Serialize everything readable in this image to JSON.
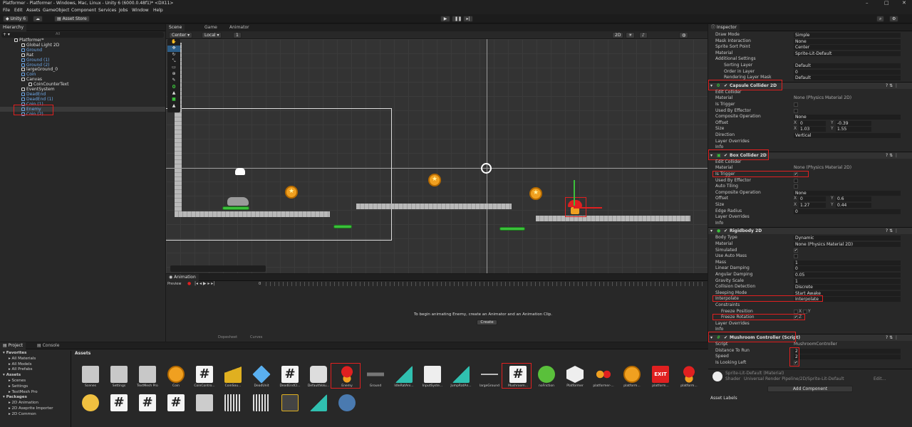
{
  "window": {
    "title": "Platformer - Platformer - Windows, Mac, Linux - Unity 6 (6000.0.48f1)* <DX11>"
  },
  "menu": [
    "File",
    "Edit",
    "Assets",
    "GameObject",
    "Component",
    "Services",
    "Jobs",
    "Window",
    "Help"
  ],
  "toolbar": {
    "account": "Unity 6",
    "asset_store": "Asset Store"
  },
  "hierarchy": {
    "tab": "Hierarchy",
    "search_placeholder": "All",
    "items": [
      {
        "label": "Platformer*",
        "indent": 0,
        "color": "#dddddd"
      },
      {
        "label": "Global Light 2D",
        "indent": 1,
        "color": "#dddddd"
      },
      {
        "label": "Ground",
        "indent": 1,
        "color": "#6fa8e8"
      },
      {
        "label": "Rat",
        "indent": 1,
        "color": "#dddddd"
      },
      {
        "label": "Ground (1)",
        "indent": 1,
        "color": "#6fa8e8"
      },
      {
        "label": "Ground (2)",
        "indent": 1,
        "color": "#6fa8e8"
      },
      {
        "label": "largeGround_0",
        "indent": 1,
        "color": "#dddddd"
      },
      {
        "label": "Coin",
        "indent": 1,
        "color": "#6fa8e8"
      },
      {
        "label": "Canvas",
        "indent": 1,
        "color": "#dddddd"
      },
      {
        "label": "CoinCounterText",
        "indent": 2,
        "color": "#dddddd"
      },
      {
        "label": "EventSystem",
        "indent": 1,
        "color": "#dddddd"
      },
      {
        "label": "DeadEnd",
        "indent": 1,
        "color": "#6fa8e8"
      },
      {
        "label": "DeadEnd (1)",
        "indent": 1,
        "color": "#6fa8e8"
      },
      {
        "label": "Coin (1)",
        "indent": 1,
        "color": "#6fa8e8"
      },
      {
        "label": "Enemy",
        "indent": 1,
        "color": "#6fa8e8"
      },
      {
        "label": "Coin (2)",
        "indent": 1,
        "color": "#6fa8e8"
      }
    ]
  },
  "scene": {
    "tabs": [
      "Scene",
      "Game",
      "Animator"
    ],
    "pivot": "Center",
    "space": "Local",
    "grid_size": "1",
    "mode_2d": "2D"
  },
  "animation": {
    "tab": "Animation",
    "preview": "Preview",
    "frame": "0",
    "message": "To begin animating Enemy, create an Animator and an Animation Clip.",
    "create_button": "Create",
    "dopesheet": "Dopesheet",
    "curves": "Curves"
  },
  "inspector": {
    "tab": "Inspector",
    "sprite_rows": [
      {
        "label": "Draw Mode",
        "value": "Simple"
      },
      {
        "label": "Mask Interaction",
        "value": "None"
      },
      {
        "label": "Sprite Sort Point",
        "value": "Center"
      },
      {
        "label": "Material",
        "value": "Sprite-Lit-Default"
      }
    ],
    "additional_settings": "Additional Settings",
    "additional_rows": [
      {
        "label": "Sorting Layer",
        "value": "Default"
      },
      {
        "label": "Order in Layer",
        "value": "0"
      },
      {
        "label": "Rendering Layer Mask",
        "value": "Default"
      }
    ],
    "capsule": {
      "title": "Capsule Collider 2D",
      "edit_collider": "Edit Collider",
      "material_label": "Material",
      "material": "None (Physics Material 2D)",
      "is_trigger": "Is Trigger",
      "used_by_effector": "Used By Effector",
      "composite_label": "Composite Operation",
      "composite": "None",
      "offset_label": "Offset",
      "offset_x": "0",
      "offset_y": "-0.39",
      "size_label": "Size",
      "size_x": "1.03",
      "size_y": "1.55",
      "direction_label": "Direction",
      "direction": "Vertical",
      "layer_overrides": "Layer Overrides",
      "info": "Info"
    },
    "box": {
      "title": "Box Collider 2D",
      "edit_collider": "Edit Collider",
      "material_label": "Material",
      "material": "None (Physics Material 2D)",
      "is_trigger": "Is Trigger",
      "used_by_effector": "Used By Effector",
      "auto_tiling": "Auto Tiling",
      "composite_label": "Composite Operation",
      "composite": "None",
      "offset_label": "Offset",
      "offset_x": "0",
      "offset_y": "0.6",
      "size_label": "Size",
      "size_x": "1.27",
      "size_y": "0.44",
      "edge_label": "Edge Radius",
      "edge": "0",
      "layer_overrides": "Layer Overrides",
      "info": "Info"
    },
    "rigidbody": {
      "title": "Rigidbody 2D",
      "rows": [
        {
          "label": "Body Type",
          "value": "Dynamic"
        },
        {
          "label": "Material",
          "value": "None (Physics Material 2D)"
        },
        {
          "label": "Simulated",
          "value": "✔"
        },
        {
          "label": "Use Auto Mass",
          "value": ""
        },
        {
          "label": "Mass",
          "value": "1"
        },
        {
          "label": "Linear Damping",
          "value": "0"
        },
        {
          "label": "Angular Damping",
          "value": "0.05"
        },
        {
          "label": "Gravity Scale",
          "value": "1"
        },
        {
          "label": "Collision Detection",
          "value": "Discrete"
        },
        {
          "label": "Sleeping Mode",
          "value": "Start Awake"
        },
        {
          "label": "Interpolate",
          "value": "Interpolate"
        }
      ],
      "constraints": "Constraints",
      "freeze_position": "Freeze Position",
      "freeze_rotation": "Freeze Rotation",
      "x": "X",
      "y": "Y",
      "z": "Z",
      "layer_overrides": "Layer Overrides",
      "info": "Info"
    },
    "script": {
      "title": "Mushroom Controller (Script)",
      "script_label": "Script",
      "script_value": "MushroomController",
      "distance_label": "Distance To Run",
      "distance": "2",
      "speed_label": "Speed",
      "speed": "2",
      "looking_label": "Is Looking Left"
    },
    "material_block": {
      "name": "Sprite-Lit-Default (Material)",
      "shader_label": "Shader",
      "shader": "Universal Render Pipeline/2D/Sprite-Lit-Default",
      "edit": "Edit..."
    },
    "add_component": "Add Component",
    "asset_labels": "Asset Labels"
  },
  "project": {
    "tabs": [
      "Project",
      "Console"
    ],
    "tree": [
      {
        "label": "Favorites",
        "indent": 0
      },
      {
        "label": "All Materials",
        "indent": 1
      },
      {
        "label": "All Models",
        "indent": 1
      },
      {
        "label": "All Prefabs",
        "indent": 1
      },
      {
        "label": "Assets",
        "indent": 0
      },
      {
        "label": "Scenes",
        "indent": 1
      },
      {
        "label": "Settings",
        "indent": 1
      },
      {
        "label": "TextMesh Pro",
        "indent": 1
      },
      {
        "label": "Packages",
        "indent": 0
      },
      {
        "label": "2D Animation",
        "indent": 1
      },
      {
        "label": "2D Aseprite Importer",
        "indent": 1
      },
      {
        "label": "2D Common",
        "indent": 1
      }
    ],
    "breadcrumb": "Assets",
    "assets": [
      {
        "label": "Scenes",
        "kind": "folder"
      },
      {
        "label": "Settings",
        "kind": "folder"
      },
      {
        "label": "TextMesh Pro",
        "kind": "folder"
      },
      {
        "label": "Coin",
        "kind": "coin"
      },
      {
        "label": "CoinContro...",
        "kind": "script"
      },
      {
        "label": "CoinSou...",
        "kind": "audio"
      },
      {
        "label": "DeadUnit",
        "kind": "cube"
      },
      {
        "label": "DeadEndCl...",
        "kind": "script"
      },
      {
        "label": "DefaultVolu...",
        "kind": "volume"
      },
      {
        "label": "Enemy",
        "kind": "mushroom"
      },
      {
        "label": "Ground",
        "kind": "ground"
      },
      {
        "label": "IdleRatAni...",
        "kind": "anim"
      },
      {
        "label": "InputSyste...",
        "kind": "input"
      },
      {
        "label": "JumpRatAn...",
        "kind": "anim"
      },
      {
        "label": "largeGround",
        "kind": "line"
      },
      {
        "label": "Mushroom...",
        "kind": "script"
      },
      {
        "label": "noFriction",
        "kind": "ball"
      },
      {
        "label": "Platformer",
        "kind": "unity"
      },
      {
        "label": "platformer-...",
        "kind": "sprites"
      },
      {
        "label": "platform...",
        "kind": "coin"
      },
      {
        "label": "platform...",
        "kind": "exit"
      },
      {
        "label": "platform...",
        "kind": "mushroom"
      }
    ]
  },
  "colors": {
    "accent_red": "#e02020",
    "selection_blue": "#2c5d87",
    "prefab_blue": "#6fa8e8"
  }
}
